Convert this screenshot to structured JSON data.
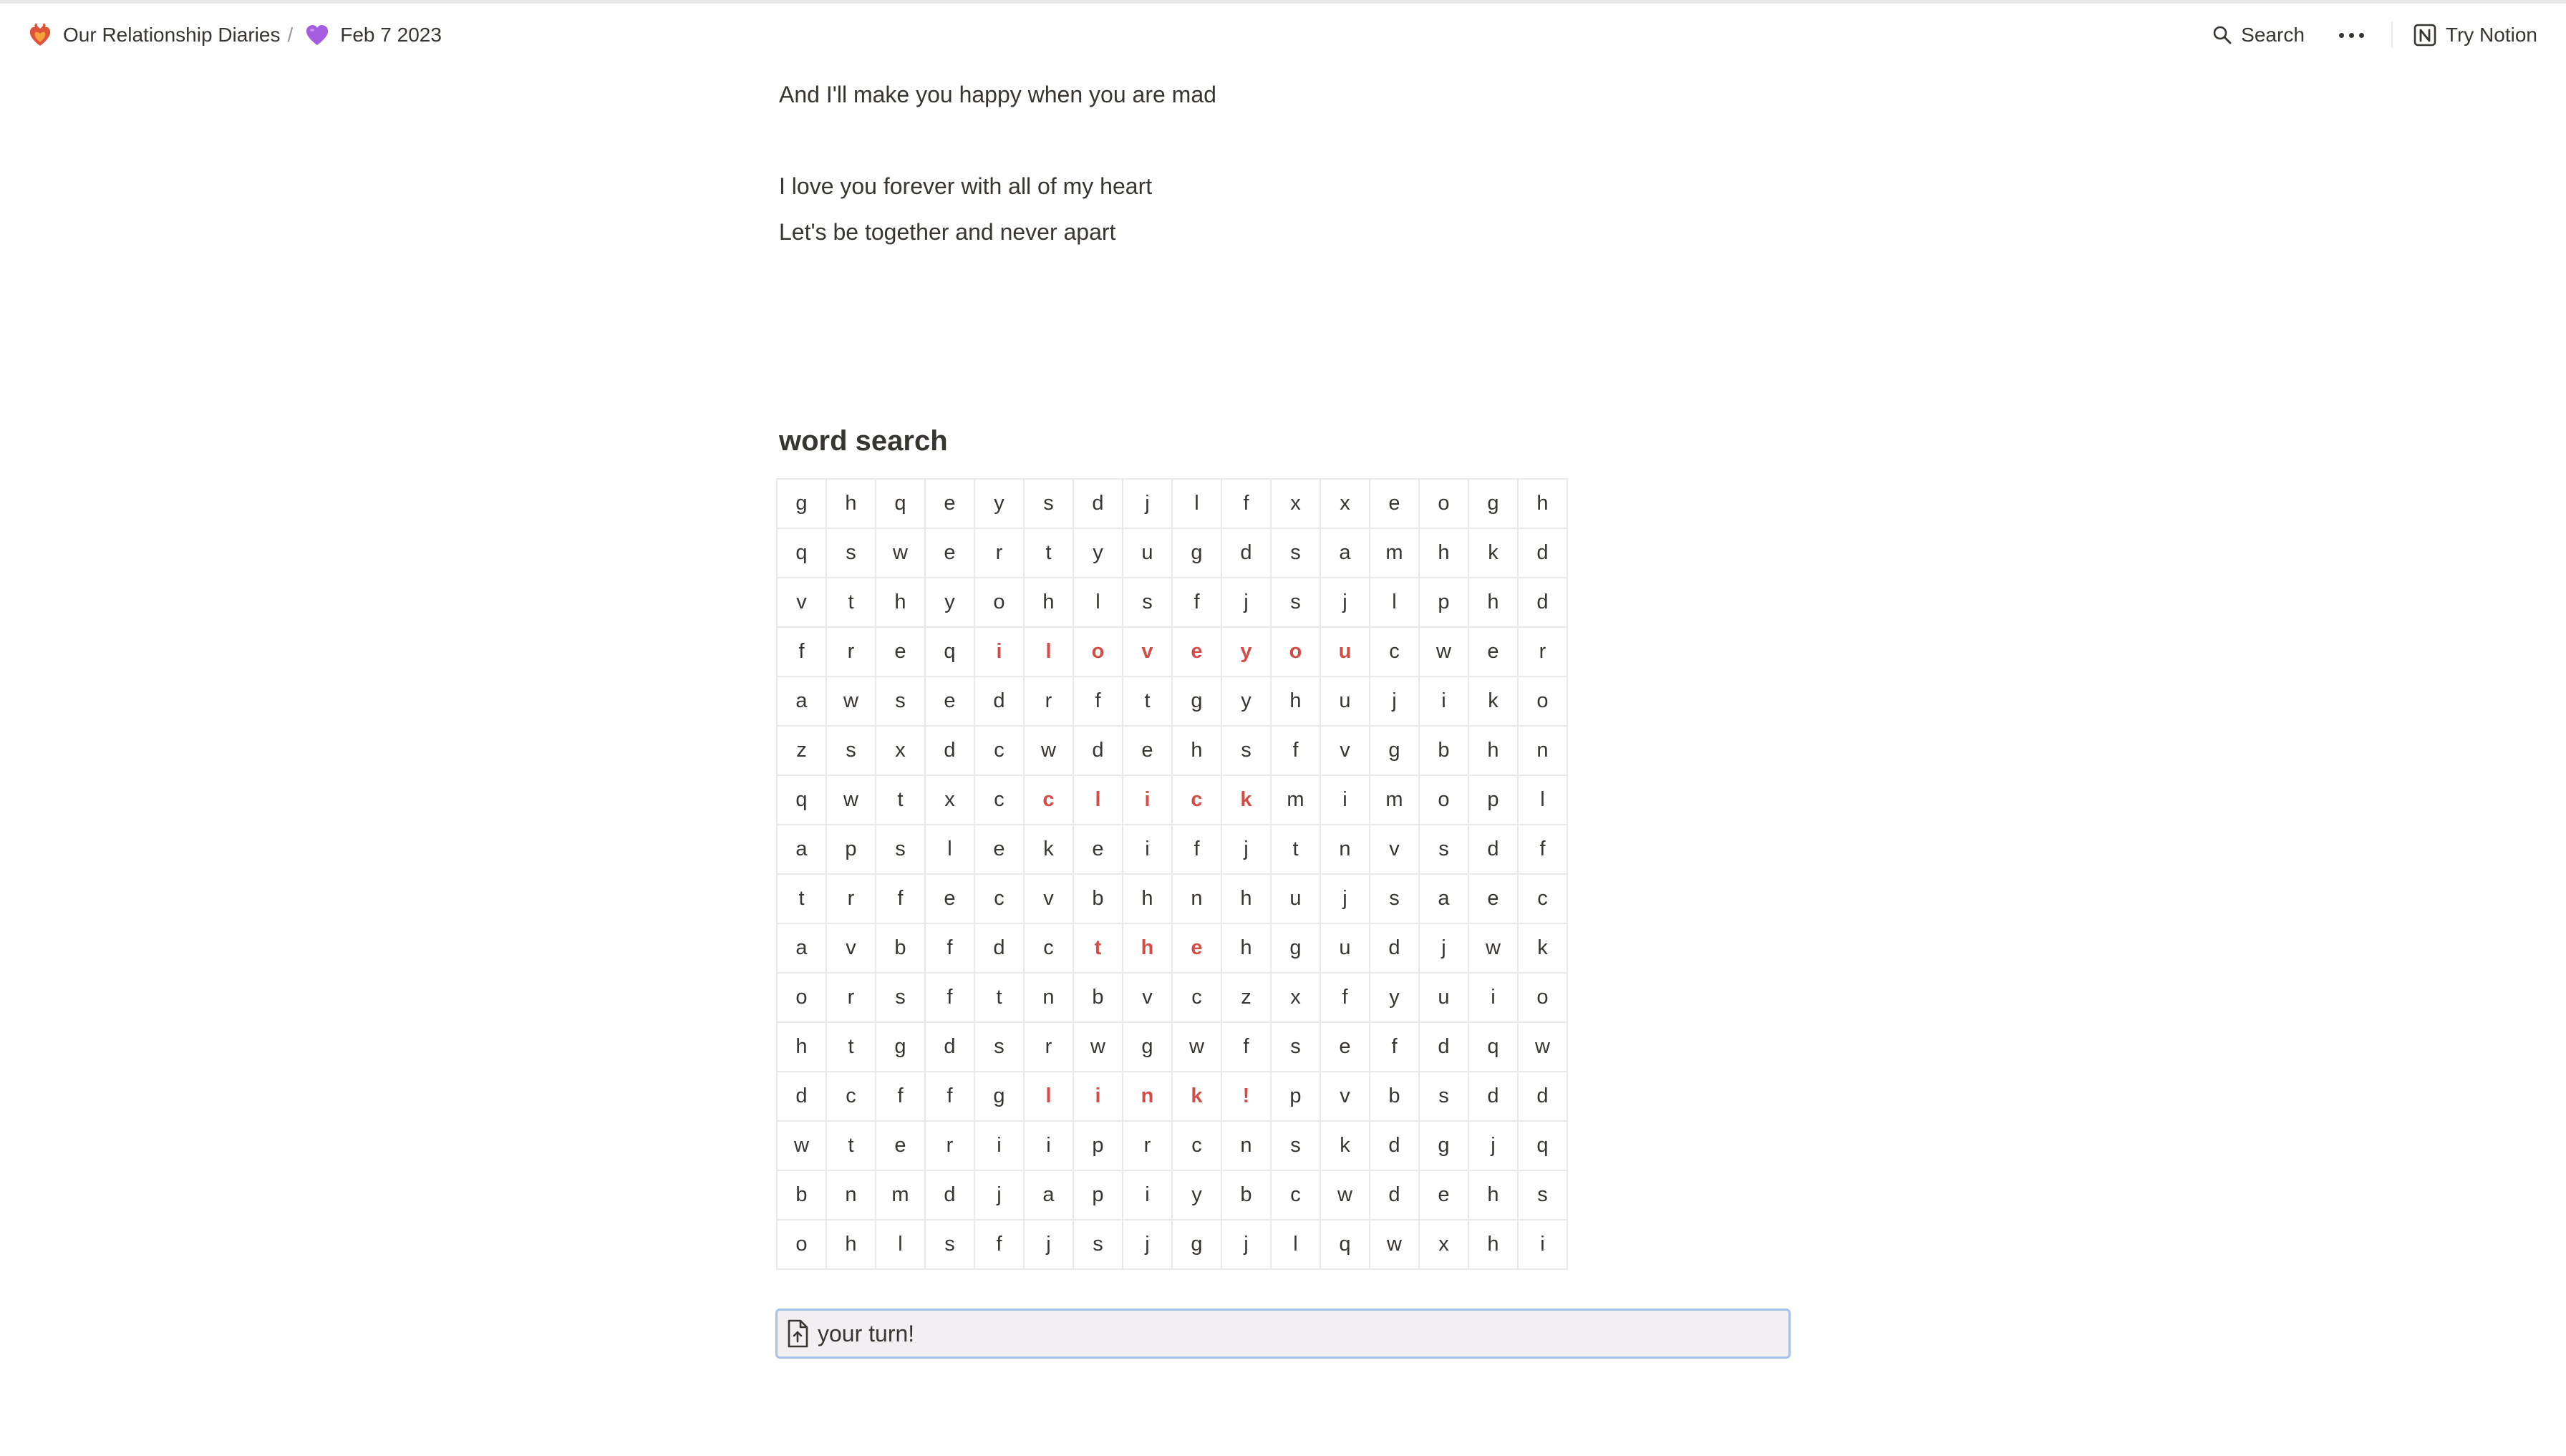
{
  "breadcrumb": {
    "parent": {
      "icon": "heart-on-fire-icon",
      "label": "Our Relationship Diaries"
    },
    "separator": "/",
    "current": {
      "icon": "purple-heart-icon",
      "label": "Feb 7 2023"
    }
  },
  "topbar": {
    "search_label": "Search",
    "more_icon": "more-horizontal-icon",
    "try_notion_label": "Try Notion"
  },
  "content": {
    "lines": [
      "And I'll make you happy when you are mad",
      "",
      "I love you forever with all of my heart",
      "Let's be together and never apart"
    ],
    "heading": "word search"
  },
  "word_search": {
    "rows": [
      [
        "g",
        "h",
        "q",
        "e",
        "y",
        "s",
        "d",
        "j",
        "l",
        "f",
        "x",
        "x",
        "e",
        "o",
        "g",
        "h"
      ],
      [
        "q",
        "s",
        "w",
        "e",
        "r",
        "t",
        "y",
        "u",
        "g",
        "d",
        "s",
        "a",
        "m",
        "h",
        "k",
        "d"
      ],
      [
        "v",
        "t",
        "h",
        "y",
        "o",
        "h",
        "l",
        "s",
        "f",
        "j",
        "s",
        "j",
        "l",
        "p",
        "h",
        "d"
      ],
      [
        "f",
        "r",
        "e",
        "q",
        "i",
        "l",
        "o",
        "v",
        "e",
        "y",
        "o",
        "u",
        "c",
        "w",
        "e",
        "r"
      ],
      [
        "a",
        "w",
        "s",
        "e",
        "d",
        "r",
        "f",
        "t",
        "g",
        "y",
        "h",
        "u",
        "j",
        "i",
        "k",
        "o"
      ],
      [
        "z",
        "s",
        "x",
        "d",
        "c",
        "w",
        "d",
        "e",
        "h",
        "s",
        "f",
        "v",
        "g",
        "b",
        "h",
        "n"
      ],
      [
        "q",
        "w",
        "t",
        "x",
        "c",
        "c",
        "l",
        "i",
        "c",
        "k",
        "m",
        "i",
        "m",
        "o",
        "p",
        "l"
      ],
      [
        "a",
        "p",
        "s",
        "l",
        "e",
        "k",
        "e",
        "i",
        "f",
        "j",
        "t",
        "n",
        "v",
        "s",
        "d",
        "f"
      ],
      [
        "t",
        "r",
        "f",
        "e",
        "c",
        "v",
        "b",
        "h",
        "n",
        "h",
        "u",
        "j",
        "s",
        "a",
        "e",
        "c"
      ],
      [
        "a",
        "v",
        "b",
        "f",
        "d",
        "c",
        "t",
        "h",
        "e",
        "h",
        "g",
        "u",
        "d",
        "j",
        "w",
        "k"
      ],
      [
        "o",
        "r",
        "s",
        "f",
        "t",
        "n",
        "b",
        "v",
        "c",
        "z",
        "x",
        "f",
        "y",
        "u",
        "i",
        "o"
      ],
      [
        "h",
        "t",
        "g",
        "d",
        "s",
        "r",
        "w",
        "g",
        "w",
        "f",
        "s",
        "e",
        "f",
        "d",
        "q",
        "w"
      ],
      [
        "d",
        "c",
        "f",
        "f",
        "g",
        "l",
        "i",
        "n",
        "k",
        "!",
        "p",
        "v",
        "b",
        "s",
        "d",
        "d"
      ],
      [
        "w",
        "t",
        "e",
        "r",
        "i",
        "i",
        "p",
        "r",
        "c",
        "n",
        "s",
        "k",
        "d",
        "g",
        "j",
        "q"
      ],
      [
        "b",
        "n",
        "m",
        "d",
        "j",
        "a",
        "p",
        "i",
        "y",
        "b",
        "c",
        "w",
        "d",
        "e",
        "h",
        "s"
      ],
      [
        "o",
        "h",
        "l",
        "s",
        "f",
        "j",
        "s",
        "j",
        "g",
        "j",
        "l",
        "q",
        "w",
        "x",
        "h",
        "i"
      ]
    ],
    "highlights": [
      {
        "row": 3,
        "cols": [
          4,
          5,
          6,
          7,
          8,
          9,
          10,
          11
        ]
      },
      {
        "row": 6,
        "cols": [
          5,
          6,
          7,
          8,
          9
        ]
      },
      {
        "row": 9,
        "cols": [
          6,
          7,
          8
        ]
      },
      {
        "row": 12,
        "cols": [
          5,
          6,
          7,
          8,
          9
        ]
      }
    ],
    "highlight_color": "#d44c47"
  },
  "turn_page": {
    "icon": "file-upload-icon",
    "label": "your turn!"
  }
}
